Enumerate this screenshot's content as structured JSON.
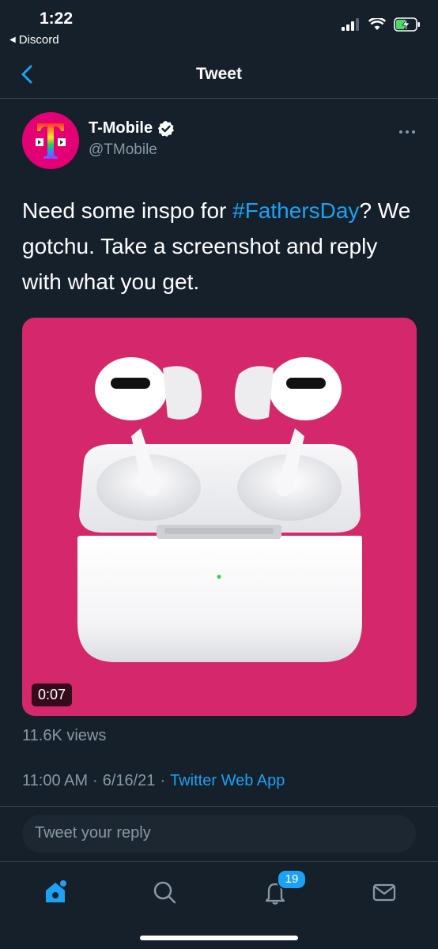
{
  "status_bar": {
    "time": "1:22",
    "back_app": "Discord"
  },
  "header": {
    "title": "Tweet"
  },
  "tweet": {
    "display_name": "T-Mobile",
    "handle": "@TMobile",
    "text_before": "Need some inspo for ",
    "hashtag": "#FathersDay",
    "text_after": "? We gotchu. Take a screenshot and reply with what you get.",
    "media_duration": "0:07",
    "views": "11.6K views",
    "time": "11:00 AM",
    "date": "6/16/21",
    "separator": "·",
    "source": "Twitter Web App",
    "avatar_letter": "T"
  },
  "reply": {
    "placeholder": "Tweet your reply"
  },
  "tabbar": {
    "notifications_badge": "19"
  },
  "colors": {
    "background": "#15202b",
    "accent": "#1da1f2",
    "brand_magenta": "#e20074",
    "media_background": "#d4286b"
  }
}
